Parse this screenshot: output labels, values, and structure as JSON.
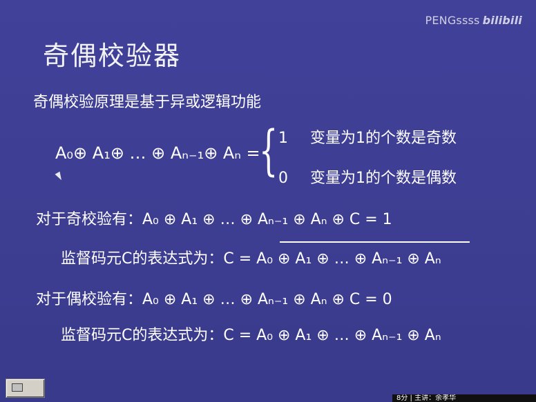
{
  "watermark": {
    "text": "PENGssss",
    "logo": "bilibili"
  },
  "slide": {
    "title": "奇偶校验器",
    "intro": "奇偶校验原理是基于异或逻辑功能",
    "formula_lhs": "A₀⊕ A₁⊕ … ⊕ Aₙ₋₁⊕ Aₙ =",
    "case1": {
      "value": "1",
      "text": "变量为1的个数是奇数"
    },
    "case0": {
      "value": "0",
      "text": "变量为1的个数是偶数"
    },
    "odd_line": "对于奇校验有：A₀ ⊕ A₁ ⊕ … ⊕ Aₙ₋₁ ⊕ Aₙ ⊕ C = 1",
    "odd_expr": "监督码元C的表达式为：C = A₀ ⊕ A₁ ⊕ … ⊕ Aₙ₋₁ ⊕ Aₙ",
    "even_line": "对于偶校验有：A₀ ⊕ A₁ ⊕ … ⊕ Aₙ₋₁ ⊕ Aₙ ⊕ C = 0",
    "even_expr": "监督码元C的表达式为：C = A₀ ⊕ A₁ ⊕ … ⊕ Aₙ₋₁ ⊕ Aₙ"
  },
  "status_bar": {
    "text": "8分 | 主讲：余孝华"
  },
  "colors": {
    "background": "#3d3d8f",
    "text": "#ffffff"
  }
}
